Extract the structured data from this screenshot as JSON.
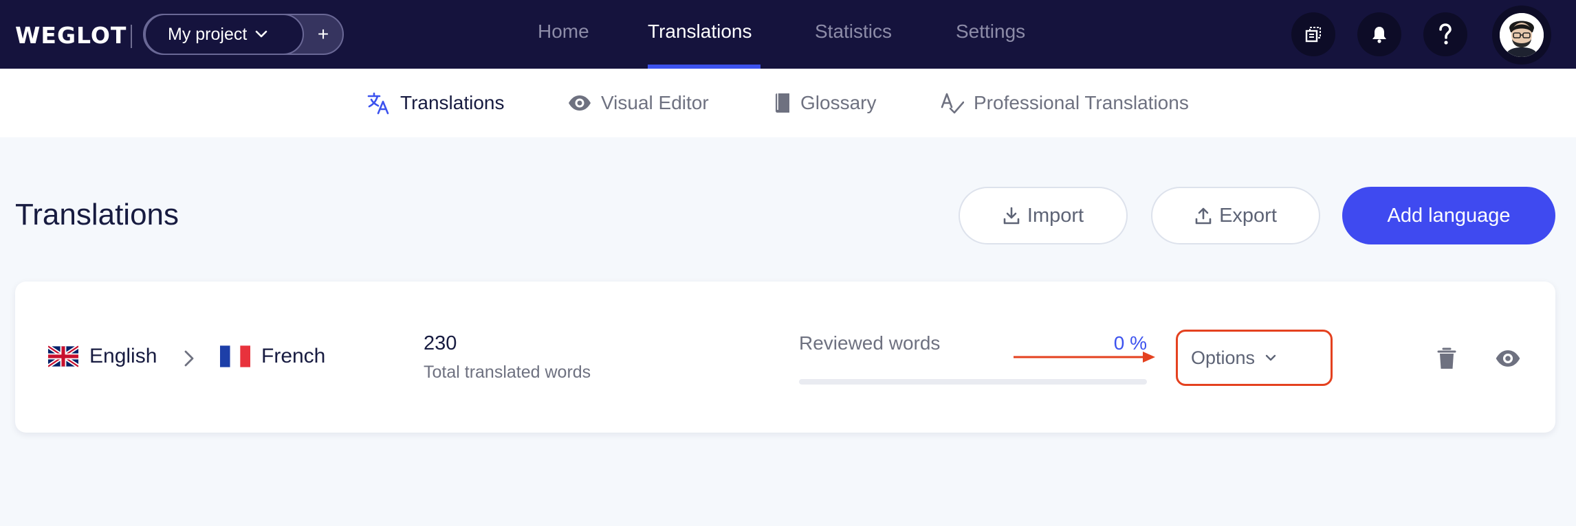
{
  "header": {
    "logo": "WEGLOT",
    "project": {
      "label": "My project",
      "add_label": "+"
    },
    "nav": [
      {
        "label": "Home",
        "active": false
      },
      {
        "label": "Translations",
        "active": true
      },
      {
        "label": "Statistics",
        "active": false
      },
      {
        "label": "Settings",
        "active": false
      }
    ],
    "icons": [
      "copy-icon",
      "bell-icon",
      "help-icon",
      "avatar"
    ]
  },
  "subnav": [
    {
      "label": "Translations",
      "icon": "translate-icon",
      "active": true
    },
    {
      "label": "Visual Editor",
      "icon": "eye-icon",
      "active": false
    },
    {
      "label": "Glossary",
      "icon": "book-icon",
      "active": false
    },
    {
      "label": "Professional Translations",
      "icon": "spellcheck-icon",
      "active": false
    }
  ],
  "page": {
    "title": "Translations",
    "import_label": "Import",
    "export_label": "Export",
    "add_language_label": "Add language"
  },
  "language_card": {
    "source": "English",
    "target": "French",
    "translated_words": "230",
    "translated_words_label": "Total translated words",
    "reviewed_label": "Reviewed words",
    "reviewed_percent": "0 %",
    "reviewed_fraction": 0,
    "options_label": "Options"
  },
  "colors": {
    "topbar": "#15133d",
    "accent": "#3c52ee",
    "primary_button": "#3f4af0",
    "highlight": "#e4411f",
    "background": "#f5f8fc"
  }
}
